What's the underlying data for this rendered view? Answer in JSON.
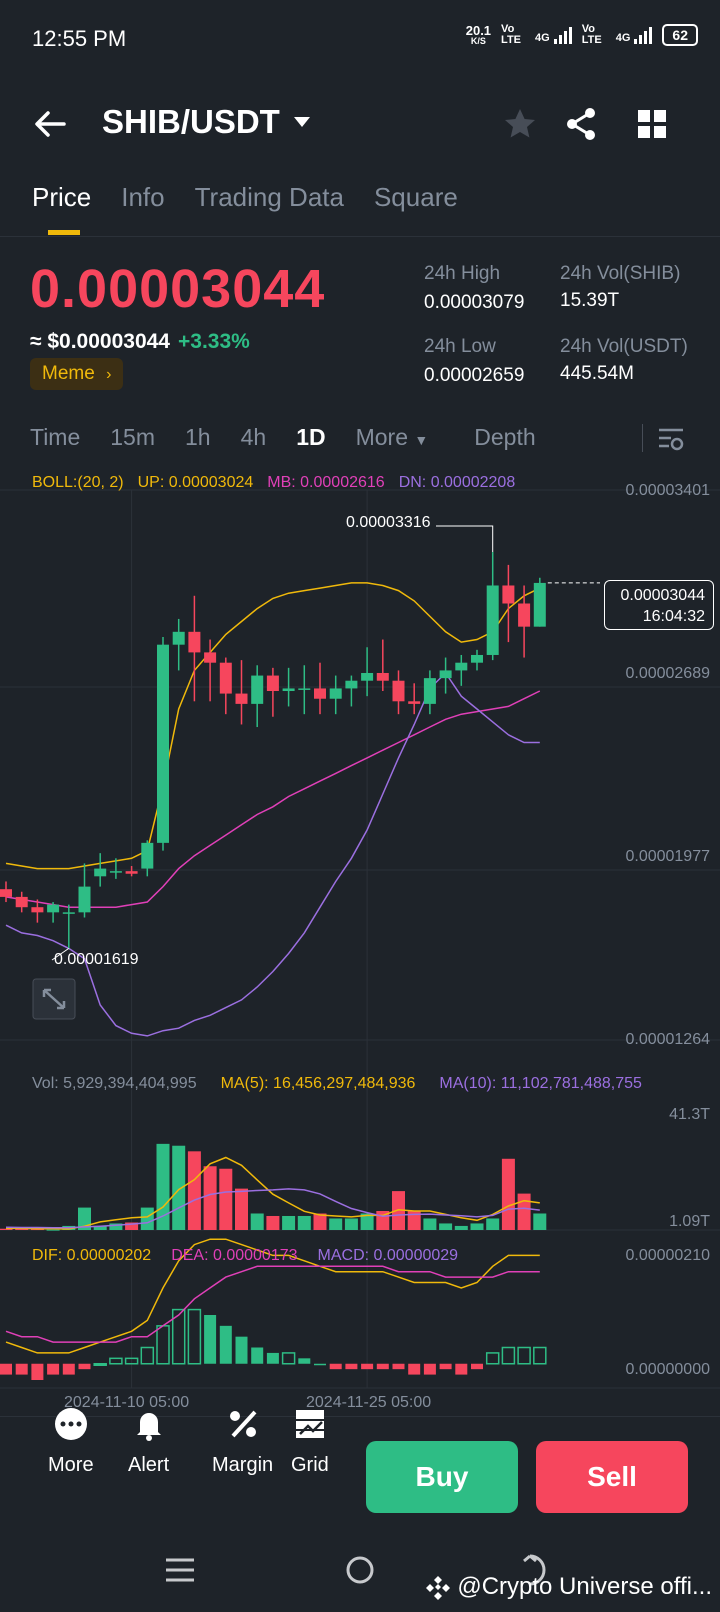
{
  "status": {
    "time": "12:55 PM",
    "net_speed": "20.1",
    "net_unit": "K/S",
    "volte1": "Vo LTE",
    "net1": "4G",
    "volte2": "Vo LTE",
    "net2": "4G",
    "battery": "62"
  },
  "header": {
    "pair": "SHIB/USDT"
  },
  "tabs": [
    {
      "label": "Price"
    },
    {
      "label": "Info"
    },
    {
      "label": "Trading Data"
    },
    {
      "label": "Square"
    }
  ],
  "price": {
    "last": "0.00003044",
    "usd": "≈ $0.00003044",
    "change": "+3.33%",
    "tag": "Meme"
  },
  "stats": {
    "high_label": "24h High",
    "high": "0.00003079",
    "low_label": "24h Low",
    "low": "0.00002659",
    "vol_shib_label": "24h Vol(SHIB)",
    "vol_shib": "15.39T",
    "vol_usdt_label": "24h Vol(USDT)",
    "vol_usdt": "445.54M"
  },
  "intervals": [
    {
      "label": "Time"
    },
    {
      "label": "15m"
    },
    {
      "label": "1h"
    },
    {
      "label": "4h"
    },
    {
      "label": "1D"
    },
    {
      "label": "More"
    },
    {
      "label": "Depth"
    }
  ],
  "boll": {
    "name": "BOLL:(20, 2)",
    "up": "UP: 0.00003024",
    "mb": "MB: 0.00002616",
    "dn": "DN: 0.00002208"
  },
  "price_axis": [
    "0.00003401",
    "0.00002689",
    "0.00001977",
    "0.00001264"
  ],
  "price_annotations": {
    "high": "0.00003316",
    "low": "0.00001619",
    "current": "0.00003044",
    "countdown": "16:04:32"
  },
  "volume": {
    "vol": "Vol: 5,929,394,404,995",
    "ma5": "MA(5): 16,456,297,484,936",
    "ma10": "MA(10): 11,102,781,488,755",
    "axis_top": "41.3T",
    "axis_bottom": "1.09T"
  },
  "macd": {
    "dif": "DIF: 0.00000202",
    "dea": "DEA: 0.00000173",
    "macd": "MACD: 0.00000029",
    "axis_top": "0.00000210",
    "axis_zero": "0.00000000"
  },
  "dates": [
    "2024-11-10 05:00",
    "2024-11-25 05:00"
  ],
  "bottom_bar": {
    "more": "More",
    "alert": "Alert",
    "margin": "Margin",
    "grid": "Grid",
    "buy": "Buy",
    "sell": "Sell"
  },
  "watermark": "@Crypto Universe offi...",
  "colors": {
    "up": "#2ebd85",
    "down": "#f6465d",
    "accent": "#f0b90b",
    "bg": "#1e2329",
    "boll_up": "#f0b90b",
    "boll_mb": "#e040b8",
    "boll_dn": "#9b6fe0"
  },
  "chart_data": {
    "type": "candlestick",
    "ohlc": [
      [
        1.85e-05,
        1.88e-05,
        1.8e-05,
        1.82e-05
      ],
      [
        1.82e-05,
        1.84e-05,
        1.76e-05,
        1.78e-05
      ],
      [
        1.78e-05,
        1.81e-05,
        1.72e-05,
        1.76e-05
      ],
      [
        1.76e-05,
        1.8e-05,
        1.72e-05,
        1.79e-05
      ],
      [
        1.76e-05,
        1.79e-05,
        1.62e-05,
        1.76e-05
      ],
      [
        1.76e-05,
        1.95e-05,
        1.74e-05,
        1.86e-05
      ],
      [
        1.9e-05,
        1.99e-05,
        1.86e-05,
        1.93e-05
      ],
      [
        1.92e-05,
        1.97e-05,
        1.89e-05,
        1.92e-05
      ],
      [
        1.92e-05,
        1.94e-05,
        1.9e-05,
        1.91e-05
      ],
      [
        1.93e-05,
        2.04e-05,
        1.9e-05,
        2.03e-05
      ],
      [
        2.03e-05,
        2.83e-05,
        2e-05,
        2.8e-05
      ],
      [
        2.8e-05,
        2.9e-05,
        2.7e-05,
        2.85e-05
      ],
      [
        2.85e-05,
        2.99e-05,
        2.58e-05,
        2.77e-05
      ],
      [
        2.77e-05,
        2.82e-05,
        2.58e-05,
        2.73e-05
      ],
      [
        2.73e-05,
        2.75e-05,
        2.53e-05,
        2.61e-05
      ],
      [
        2.61e-05,
        2.74e-05,
        2.49e-05,
        2.57e-05
      ],
      [
        2.57e-05,
        2.72e-05,
        2.48e-05,
        2.68e-05
      ],
      [
        2.68e-05,
        2.71e-05,
        2.52e-05,
        2.62e-05
      ],
      [
        2.62e-05,
        2.71e-05,
        2.56e-05,
        2.63e-05
      ],
      [
        2.63e-05,
        2.72e-05,
        2.53e-05,
        2.63e-05
      ],
      [
        2.63e-05,
        2.73e-05,
        2.53e-05,
        2.59e-05
      ],
      [
        2.59e-05,
        2.68e-05,
        2.53e-05,
        2.63e-05
      ],
      [
        2.63e-05,
        2.68e-05,
        2.56e-05,
        2.66e-05
      ],
      [
        2.66e-05,
        2.79e-05,
        2.6e-05,
        2.69e-05
      ],
      [
        2.69e-05,
        2.82e-05,
        2.62e-05,
        2.66e-05
      ],
      [
        2.66e-05,
        2.7e-05,
        2.53e-05,
        2.58e-05
      ],
      [
        2.58e-05,
        2.65e-05,
        2.53e-05,
        2.57e-05
      ],
      [
        2.57e-05,
        2.7e-05,
        2.53e-05,
        2.67e-05
      ],
      [
        2.67e-05,
        2.75e-05,
        2.61e-05,
        2.7e-05
      ],
      [
        2.7e-05,
        2.76e-05,
        2.64e-05,
        2.73e-05
      ],
      [
        2.73e-05,
        2.78e-05,
        2.7e-05,
        2.76e-05
      ],
      [
        2.76e-05,
        3.16e-05,
        2.74e-05,
        3.03e-05
      ],
      [
        3.03e-05,
        3.11e-05,
        2.81e-05,
        2.96e-05
      ],
      [
        2.96e-05,
        3.03e-05,
        2.75e-05,
        2.87e-05
      ],
      [
        2.87e-05,
        3.06e-05,
        2.87e-05,
        3.04e-05
      ]
    ],
    "boll_up": [
      1.95e-05,
      1.94e-05,
      1.93e-05,
      1.93e-05,
      1.93e-05,
      1.94e-05,
      1.95e-05,
      1.96e-05,
      1.97e-05,
      2e-05,
      2.25e-05,
      2.55e-05,
      2.7e-05,
      2.77e-05,
      2.84e-05,
      2.89e-05,
      2.94e-05,
      2.98e-05,
      3e-05,
      3.01e-05,
      3.02e-05,
      3.03e-05,
      3.04e-05,
      3.04e-05,
      3.03e-05,
      3.01e-05,
      2.97e-05,
      2.91e-05,
      2.85e-05,
      2.81e-05,
      2.82e-05,
      2.85e-05,
      2.94e-05,
      2.99e-05,
      3.02e-05
    ],
    "boll_mb": [
      1.82e-05,
      1.81e-05,
      1.8e-05,
      1.79e-05,
      1.78e-05,
      1.78e-05,
      1.78e-05,
      1.78e-05,
      1.79e-05,
      1.8e-05,
      1.86e-05,
      1.93e-05,
      1.98e-05,
      2.02e-05,
      2.06e-05,
      2.1e-05,
      2.14e-05,
      2.17e-05,
      2.21e-05,
      2.24e-05,
      2.27e-05,
      2.3e-05,
      2.33e-05,
      2.36e-05,
      2.39e-05,
      2.42e-05,
      2.45e-05,
      2.48e-05,
      2.51e-05,
      2.53e-05,
      2.54e-05,
      2.55e-05,
      2.56e-05,
      2.59e-05,
      2.62e-05
    ],
    "boll_dn": [
      1.71e-05,
      1.68e-05,
      1.67e-05,
      1.65e-05,
      1.62e-05,
      1.58e-05,
      1.4e-05,
      1.32e-05,
      1.29e-05,
      1.28e-05,
      1.3e-05,
      1.31e-05,
      1.34e-05,
      1.36e-05,
      1.39e-05,
      1.42e-05,
      1.47e-05,
      1.53e-05,
      1.6e-05,
      1.68e-05,
      1.78e-05,
      1.88e-05,
      1.97e-05,
      2.08e-05,
      2.22e-05,
      2.36e-05,
      2.49e-05,
      2.63e-05,
      2.69e-05,
      2.6e-05,
      2.55e-05,
      2.5e-05,
      2.45e-05,
      2.42e-05,
      2.42e-05
    ],
    "volume": [
      1.5,
      1.5,
      1.4,
      1.2,
      2.4,
      8.3,
      2.4,
      3.2,
      3.5,
      8.3,
      28.8,
      28.2,
      26.4,
      21.6,
      20.8,
      14.4,
      6.4,
      5.6,
      5.6,
      5.6,
      6.4,
      4.8,
      4.8,
      6.4,
      7.2,
      13.6,
      7.2,
      4.8,
      3.2,
      2.4,
      3.2,
      4.8,
      24.0,
      12.8,
      6.4
    ],
    "vol_ma5": [
      1.6,
      1.6,
      1.5,
      1.5,
      1.4,
      2.3,
      3.7,
      4.4,
      5.0,
      5.3,
      8.5,
      14.1,
      17.3,
      22.4,
      24.4,
      21.9,
      17.2,
      12.6,
      9.8,
      7.1,
      5.9,
      5.6,
      5.3,
      5.8,
      5.8,
      7.6,
      7.2,
      7.2,
      6.1,
      5.0,
      4.2,
      6.1,
      8.8,
      10.5,
      9.8
    ],
    "vol_ma10": [
      2.0,
      1.9,
      1.9,
      1.8,
      1.8,
      2.1,
      2.3,
      2.6,
      3.0,
      3.4,
      5.6,
      8.2,
      10.7,
      12.5,
      13.3,
      13.5,
      13.8,
      14.0,
      14.3,
      14.0,
      12.7,
      10.3,
      8.0,
      6.7,
      5.5,
      5.9,
      6.1,
      6.2,
      5.9,
      5.7,
      5.3,
      5.8,
      7.8,
      8.1,
      7.5
    ],
    "dif": [
      0.4,
      0.3,
      0.2,
      0.2,
      0.2,
      0.3,
      0.4,
      0.5,
      0.6,
      0.8,
      1.4,
      1.9,
      2.2,
      2.3,
      2.3,
      2.2,
      2.1,
      2.0,
      2.0,
      1.9,
      1.8,
      1.7,
      1.7,
      1.7,
      1.7,
      1.6,
      1.5,
      1.5,
      1.5,
      1.4,
      1.5,
      1.8,
      2.0,
      2.0,
      2.0
    ],
    "dea": [
      0.6,
      0.5,
      0.5,
      0.4,
      0.4,
      0.4,
      0.4,
      0.4,
      0.5,
      0.5,
      0.7,
      0.9,
      1.2,
      1.4,
      1.6,
      1.7,
      1.8,
      1.8,
      1.8,
      1.8,
      1.8,
      1.8,
      1.8,
      1.8,
      1.8,
      1.7,
      1.7,
      1.7,
      1.6,
      1.6,
      1.6,
      1.6,
      1.7,
      1.7,
      1.7
    ],
    "macd_hist": [
      -0.2,
      -0.2,
      -0.3,
      -0.2,
      -0.2,
      -0.1,
      0.0,
      0.1,
      0.1,
      0.3,
      0.7,
      1.0,
      1.0,
      0.9,
      0.7,
      0.5,
      0.3,
      0.2,
      0.2,
      0.1,
      0.0,
      -0.1,
      -0.1,
      -0.1,
      -0.1,
      -0.1,
      -0.2,
      -0.2,
      -0.1,
      -0.2,
      -0.1,
      0.2,
      0.3,
      0.3,
      0.3
    ],
    "price_ylim": [
      1.264e-05,
      3.401e-05
    ],
    "volume_ylim": [
      1.09,
      41.3
    ],
    "macd_ylim": [
      -0.3,
      2.1
    ]
  }
}
